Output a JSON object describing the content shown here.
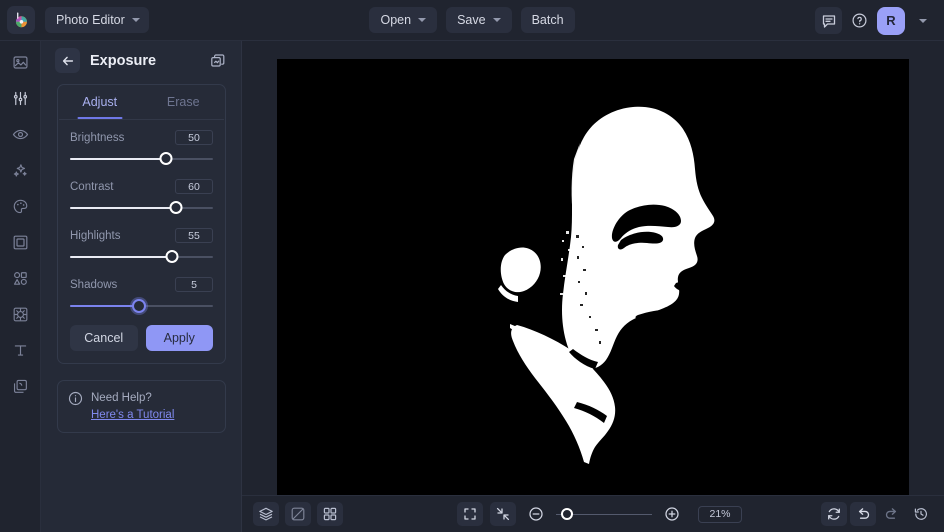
{
  "app": {
    "logo_icon": "color-wheel-logo",
    "menu_label": "Photo Editor",
    "menu_chevron_icon": "chevron-down-icon"
  },
  "topbar": {
    "open_label": "Open",
    "open_chevron_icon": "chevron-down-icon",
    "save_label": "Save",
    "save_chevron_icon": "chevron-down-icon",
    "batch_label": "Batch",
    "comment_icon": "chat-bubble-icon",
    "help_icon": "question-circle-icon",
    "avatar_initial": "R",
    "account_chevron_icon": "chevron-down-icon"
  },
  "rail": {
    "items": [
      {
        "name": "image-icon",
        "title": "Image"
      },
      {
        "name": "adjustments-icon",
        "title": "Adjust"
      },
      {
        "name": "eye-icon",
        "title": "Retouch"
      },
      {
        "name": "sparkles-icon",
        "title": "Effects"
      },
      {
        "name": "palette-icon",
        "title": "Color"
      },
      {
        "name": "frame-icon",
        "title": "Frame"
      },
      {
        "name": "shapes-icon",
        "title": "Shapes"
      },
      {
        "name": "texture-icon",
        "title": "Texture"
      },
      {
        "name": "text-icon",
        "title": "Text"
      },
      {
        "name": "layers-stack-icon",
        "title": "Layers"
      }
    ]
  },
  "panel": {
    "back_icon": "arrow-left-icon",
    "title": "Exposure",
    "duplicate_icon": "duplicate-layers-icon",
    "tabs": [
      {
        "label": "Adjust",
        "active": true
      },
      {
        "label": "Erase",
        "active": false
      }
    ],
    "sliders": [
      {
        "label": "Brightness",
        "value": "50",
        "percent": 67,
        "active": false
      },
      {
        "label": "Contrast",
        "value": "60",
        "percent": 74,
        "active": false
      },
      {
        "label": "Highlights",
        "value": "55",
        "percent": 71,
        "active": false
      },
      {
        "label": "Shadows",
        "value": "5",
        "percent": 48,
        "active": true
      }
    ],
    "cancel_label": "Cancel",
    "apply_label": "Apply",
    "help": {
      "icon": "info-circle-icon",
      "title": "Need Help?",
      "link": "Here's a Tutorial"
    }
  },
  "bottombar": {
    "layers_icon": "layers-icon",
    "compare_icon": "compare-split-icon",
    "grid_icon": "grid-view-icon",
    "fit_icon": "expand-frame-icon",
    "actual_icon": "collapse-frame-icon",
    "zoom_out_icon": "minus-circle-icon",
    "zoom_in_icon": "plus-circle-icon",
    "zoom_value": "21%",
    "zoom_percent": 11,
    "reset_icon": "refresh-icon",
    "undo_icon": "undo-arrow-icon",
    "redo_icon": "redo-arrow-icon",
    "history_icon": "history-clock-icon"
  },
  "canvas": {
    "artwork_name": "high-contrast-profile-portrait",
    "background_color": "#000000"
  },
  "colors": {
    "accent": "#8f97f5",
    "accent_dim": "#7b83ee",
    "panel_bg": "#252a37",
    "app_bg": "#20242f",
    "text": "#d6d9e4",
    "muted": "#9097ad"
  }
}
